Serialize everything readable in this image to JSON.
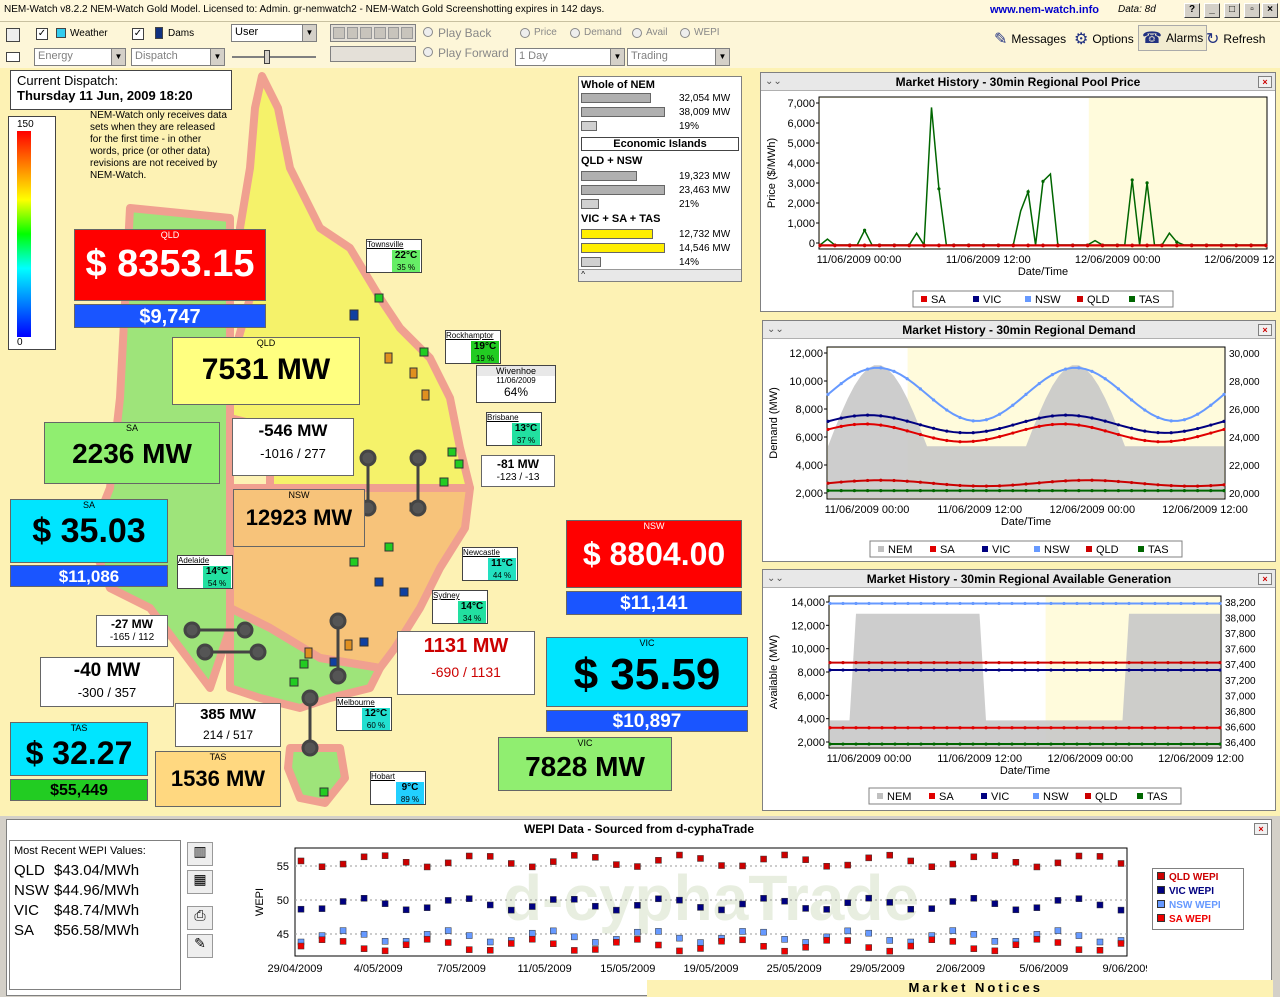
{
  "app": {
    "title": "NEM-Watch v8.2.2 NEM-Watch Gold Model.    Licensed to: Admin.  gr-nemwatch2 - NEM-Watch Gold Screenshotting expires in 142 days.",
    "url": "www.nem-watch.info",
    "data_label": "Data: 8d"
  },
  "toolbar": {
    "weather": "Weather",
    "dams": "Dams",
    "user_select": "User",
    "energy_select": "Energy",
    "dispatch_select": "Dispatch",
    "play_back": "Play Back",
    "play_forward": "Play Forward",
    "price": "Price",
    "demand": "Demand",
    "avail": "Avail",
    "wepi": "WEPI",
    "range_select": "1 Day",
    "trading_select": "Trading",
    "messages": "Messages",
    "options": "Options",
    "alarms": "Alarms",
    "refresh": "Refresh"
  },
  "dispatch": {
    "label": "Current Dispatch:",
    "datetime": "Thursday 11 Jun, 2009 18:20",
    "note": "NEM-Watch only receives data sets when they are released for the first time - in other words, price (or other data) revisions are not received by NEM-Watch.",
    "scale_max": "150",
    "scale_min": "0"
  },
  "nem_summary": {
    "whole_title": "Whole of NEM",
    "whole": [
      "32,054 MW",
      "38,009 MW",
      "19%"
    ],
    "islands_title": "Economic Islands",
    "qn_title": "QLD + NSW",
    "qn": [
      "19,323 MW",
      "23,463 MW",
      "21%"
    ],
    "vst_title": "VIC + SA + TAS",
    "vst": [
      "12,732 MW",
      "14,546 MW",
      "14%"
    ]
  },
  "regions": {
    "qld": {
      "name": "QLD",
      "price": "$ 8353.15",
      "cap": "$9,747",
      "demand": "7531 MW",
      "color": "#ff0000"
    },
    "nsw": {
      "name": "NSW",
      "price": "$ 8804.00",
      "cap": "$11,141",
      "demand": "12923 MW",
      "color": "#ff0000"
    },
    "vic": {
      "name": "VIC",
      "price": "$ 35.59",
      "cap": "$10,897",
      "demand": "7828 MW",
      "color": "#00e5ff"
    },
    "sa": {
      "name": "SA",
      "price": "$ 35.03",
      "cap": "$11,086",
      "demand": "2236 MW",
      "color": "#00e5ff"
    },
    "tas": {
      "name": "TAS",
      "price": "$ 32.27",
      "cap": "$55,449",
      "demand": "1536 MW",
      "color": "#00e5ff"
    }
  },
  "interconnectors": {
    "qld_nsw_a": {
      "flow": "-546 MW",
      "range": "-1016 / 277"
    },
    "qld_nsw_b": {
      "flow": "-81 MW",
      "range": "-123 / -13"
    },
    "vic_nsw": {
      "flow": "1131 MW",
      "range": "-690 / 1131"
    },
    "sa_vic_a": {
      "flow": "-27 MW",
      "range": "-165 / 112"
    },
    "sa_vic_b": {
      "flow": "-40 MW",
      "range": "-300 / 357"
    },
    "tas_vic": {
      "flow": "385 MW",
      "range": "214 / 517"
    }
  },
  "weather": {
    "townsville": {
      "city": "Townsville",
      "temp": "22°C",
      "hum": "35 %"
    },
    "rockhampton": {
      "city": "Rockhamptor",
      "temp": "19°C",
      "hum": "19 %"
    },
    "brisbane": {
      "city": "Brisbane",
      "temp": "13°C",
      "hum": "37 %"
    },
    "newcastle": {
      "city": "Newcastle",
      "temp": "11°C",
      "hum": "44 %"
    },
    "sydney": {
      "city": "Sydney",
      "temp": "14°C",
      "hum": "34 %"
    },
    "adelaide": {
      "city": "Adelaide",
      "temp": "14°C",
      "hum": "54 %"
    },
    "melbourne": {
      "city": "Melbourne",
      "temp": "12°C",
      "hum": "60 %"
    },
    "hobart": {
      "city": "Hobart",
      "temp": "9°C",
      "hum": "89 %"
    }
  },
  "dam": {
    "name": "Wivenhoe",
    "date": "11/06/2009",
    "pct": "64%"
  },
  "charts": {
    "price": {
      "title": "Market History - 30min Regional Pool Price",
      "ylabel": "Price ($/MWh)",
      "xlabel": "Date/Time",
      "yticks": [
        "7,000",
        "6,000",
        "5,000",
        "4,000",
        "3,000",
        "2,000",
        "1,000",
        "0"
      ],
      "xticks": [
        "11/06/2009 00:00",
        "11/06/2009 12:00",
        "12/06/2009 00:00",
        "12/06/2009 12:00"
      ],
      "legend": [
        "SA",
        "VIC",
        "NSW",
        "QLD",
        "TAS"
      ]
    },
    "demand": {
      "title": "Market History - 30min Regional Demand",
      "ylabel": "Demand (MW)",
      "xlabel": "Date/Time",
      "yticks": [
        "12,000",
        "10,000",
        "8,000",
        "6,000",
        "4,000",
        "2,000"
      ],
      "y2ticks": [
        "30,000",
        "28,000",
        "26,000",
        "24,000",
        "22,000",
        "20,000"
      ],
      "xticks": [
        "11/06/2009 00:00",
        "11/06/2009 12:00",
        "12/06/2009 00:00",
        "12/06/2009 12:00"
      ],
      "legend": [
        "NEM",
        "SA",
        "VIC",
        "NSW",
        "QLD",
        "TAS"
      ]
    },
    "avail": {
      "title": "Market History - 30min Regional Available Generation",
      "ylabel": "Available (MW)",
      "xlabel": "Date/Time",
      "yticks": [
        "14,000",
        "12,000",
        "10,000",
        "8,000",
        "6,000",
        "4,000",
        "2,000"
      ],
      "y2ticks": [
        "38,200",
        "38,000",
        "37,800",
        "37,600",
        "37,400",
        "37,200",
        "37,000",
        "36,800",
        "36,600",
        "36,400"
      ],
      "xticks": [
        "11/06/2009 00:00",
        "11/06/2009 12:00",
        "12/06/2009 00:00",
        "12/06/2009 12:00"
      ],
      "legend": [
        "NEM",
        "SA",
        "VIC",
        "NSW",
        "QLD",
        "TAS"
      ]
    }
  },
  "wepi": {
    "title": "WEPI Data - Sourced from d-cyphaTrade",
    "recent_title": "Most Recent WEPI Values:",
    "values": [
      {
        "region": "QLD",
        "value": "$43.04/MWh"
      },
      {
        "region": "NSW",
        "value": "$44.96/MWh"
      },
      {
        "region": "VIC",
        "value": "$48.74/MWh"
      },
      {
        "region": "SA",
        "value": "$56.58/MWh"
      }
    ],
    "ylabel": "WEPI",
    "yticks": [
      "55",
      "50",
      "45"
    ],
    "xticks": [
      "29/04/2009",
      "4/05/2009",
      "7/05/2009",
      "11/05/2009",
      "15/05/2009",
      "19/05/2009",
      "25/05/2009",
      "29/05/2009",
      "2/06/2009",
      "5/06/2009",
      "9/06/2009"
    ],
    "legend": [
      "QLD WEPI",
      "VIC WEPI",
      "NSW WEPI",
      "SA WEPI"
    ],
    "watermark": "d-cyphaTrade",
    "market_notices": "Market Notices"
  },
  "colors": {
    "sa": "#e00000",
    "vic": "#000080",
    "nsw": "#6699ff",
    "qld": "#cc0000",
    "tas": "#006600",
    "nem": "#c0c0c0"
  }
}
